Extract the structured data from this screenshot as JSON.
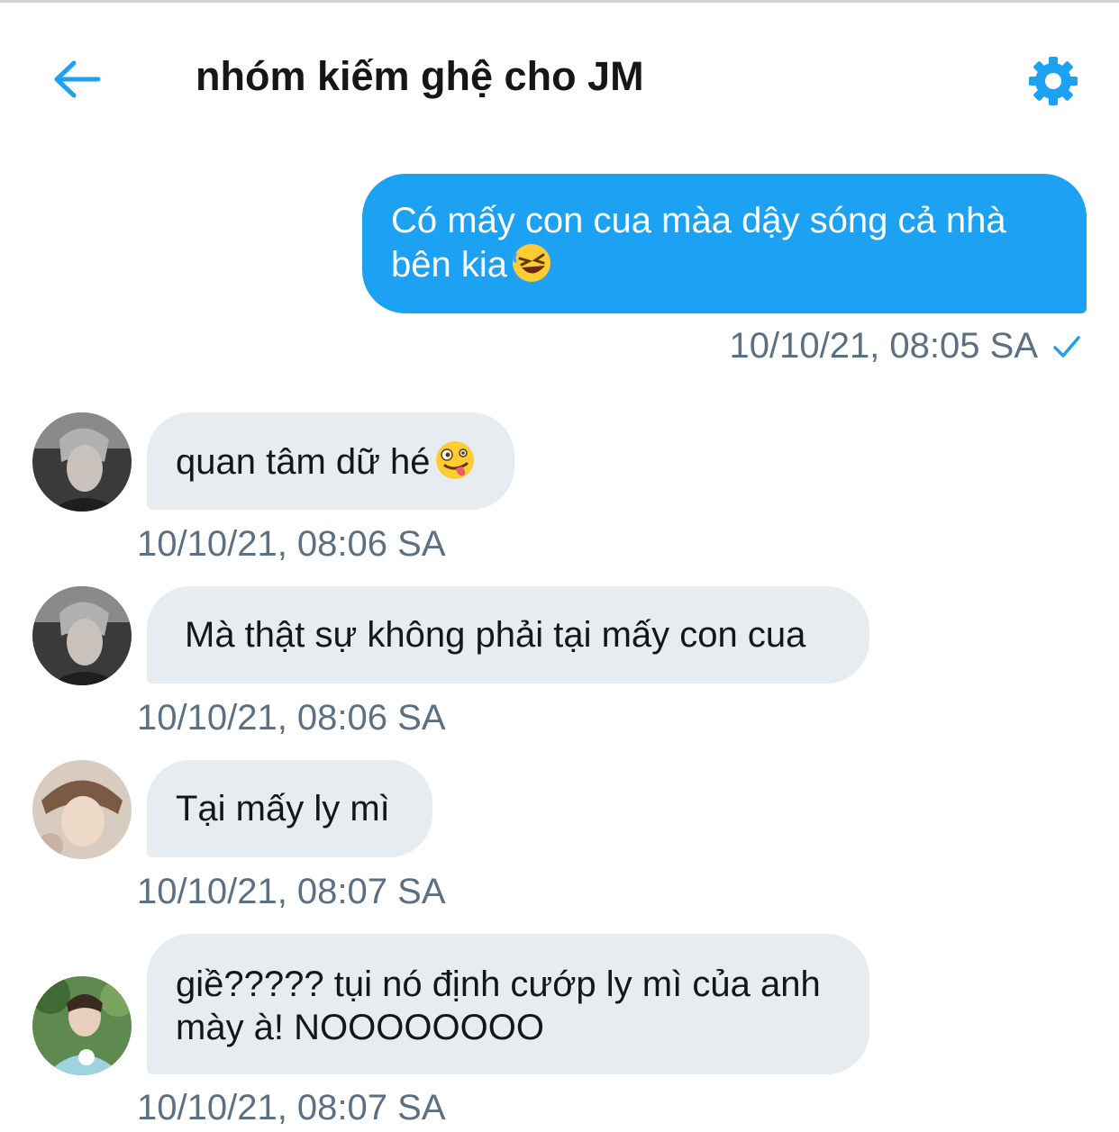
{
  "header": {
    "back_icon": "arrow-left-icon",
    "title": "nhóm kiếm ghệ cho JM",
    "settings_icon": "gear-icon"
  },
  "colors": {
    "accent": "#1da1f2",
    "incoming_bubble": "#e6ecf0",
    "timestamp": "#5b7083"
  },
  "messages": [
    {
      "direction": "outgoing",
      "text": "Có mấy con cua màa dậy sóng cả nhà bên kia",
      "emoji": "rolling-on-floor-laughing-emoji",
      "time": "10/10/21, 08:05 SA",
      "status_icon": "check-icon"
    },
    {
      "direction": "incoming",
      "text": "quan tâm dữ hé",
      "emoji": "zany-face-emoji",
      "time": "10/10/21, 08:06 SA",
      "avatar": "avatar-1"
    },
    {
      "direction": "incoming",
      "text": "Mà thật sự không phải tại mấy con cua",
      "time": "10/10/21, 08:06 SA",
      "avatar": "avatar-1"
    },
    {
      "direction": "incoming",
      "text": "Tại mấy ly mì",
      "time": "10/10/21, 08:07 SA",
      "avatar": "avatar-2"
    },
    {
      "direction": "incoming",
      "text_line1": "giề????? tụi nó định cướp ly mì của anh",
      "text_line2": "mày à! NOOOOOOOO",
      "time": "10/10/21, 08:07 SA",
      "avatar": "avatar-3"
    }
  ]
}
